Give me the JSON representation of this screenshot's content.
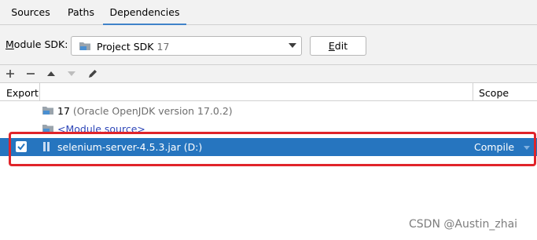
{
  "tabs": [
    {
      "label": "Sources"
    },
    {
      "label": "Paths"
    },
    {
      "label": "Dependencies"
    }
  ],
  "sdk": {
    "label_prefix": "M",
    "label_rest": "odule SDK:",
    "name": "Project SDK",
    "version": "17",
    "edit_label_prefix": "E",
    "edit_label_rest": "dit"
  },
  "toolbar": {
    "add_icon": "plus-icon",
    "remove_icon": "minus-icon",
    "up_icon": "arrow-up-icon",
    "down_icon": "arrow-down-icon",
    "edit_icon": "pencil-icon"
  },
  "table": {
    "headers": {
      "export": "Export",
      "scope": "Scope"
    },
    "rows": [
      {
        "name": "17",
        "detail": "(Oracle OpenJDK version 17.0.2)"
      },
      {
        "name": "<Module source>"
      },
      {
        "name": "selenium-server-4.5.3.jar",
        "detail": "(D:)",
        "scope": "Compile",
        "checked": true
      }
    ]
  },
  "watermark": "CSDN @Austin_zhai",
  "colors": {
    "selection": "#2675bf",
    "accent": "#4083c9",
    "highlight": "#e0242a"
  }
}
